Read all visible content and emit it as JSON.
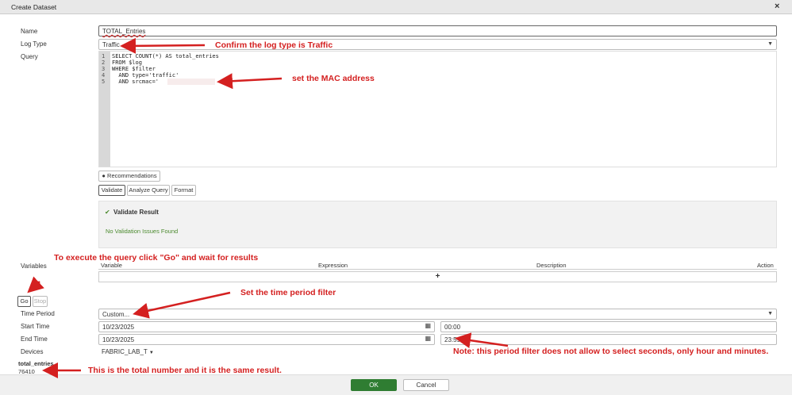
{
  "dialog": {
    "title": "Create Dataset",
    "close_glyph": "×"
  },
  "form": {
    "name_label": "Name",
    "name_value": "TOTAL_Entries",
    "log_type_label": "Log Type",
    "log_type_value": "Traffic",
    "query_label": "Query",
    "query_lines": [
      "SELECT COUNT(*) AS total_entries",
      "FROM $log",
      "WHERE $filter",
      "  AND type='traffic'",
      "  AND srcmac='"
    ],
    "line_numbers": [
      "1",
      "2",
      "3",
      "4",
      "5"
    ],
    "recommendations_label": "Recommendations",
    "validate_label": "Validate",
    "analyze_label": "Analyze Query",
    "format_label": "Format",
    "validate_result_title": "Validate Result",
    "validate_result_message": "No Validation Issues Found",
    "variables_label": "Variables",
    "variables_columns": [
      "Variable",
      "Expression",
      "Description",
      "Action"
    ],
    "add_glyph": "+",
    "go_label": "Go",
    "stop_label": "Stop",
    "time_period_label": "Time Period",
    "time_period_value": "Custom...",
    "start_time_label": "Start Time",
    "start_date": "10/23/2025",
    "start_time": "00:00",
    "end_time_label": "End Time",
    "end_date": "10/23/2025",
    "end_time": "23:59",
    "devices_label": "Devices",
    "devices_value": "FABRIC_LAB_T",
    "result_column": "total_entries",
    "result_value": "76410"
  },
  "footer": {
    "ok_label": "OK",
    "cancel_label": "Cancel"
  },
  "annotations": {
    "log_type": "Confirm the log type is Traffic",
    "mac": "set the MAC address",
    "go": "To execute the query click \"Go\" and wait for results",
    "time": "Set the time period filter",
    "note": "Note: this period filter does not allow to select seconds, only hour and minutes.",
    "total": "This is the total number and it is the same result."
  },
  "colors": {
    "annotation": "#d42020",
    "ok": "#2f7d32",
    "validate_ok": "#4b8a2e"
  }
}
